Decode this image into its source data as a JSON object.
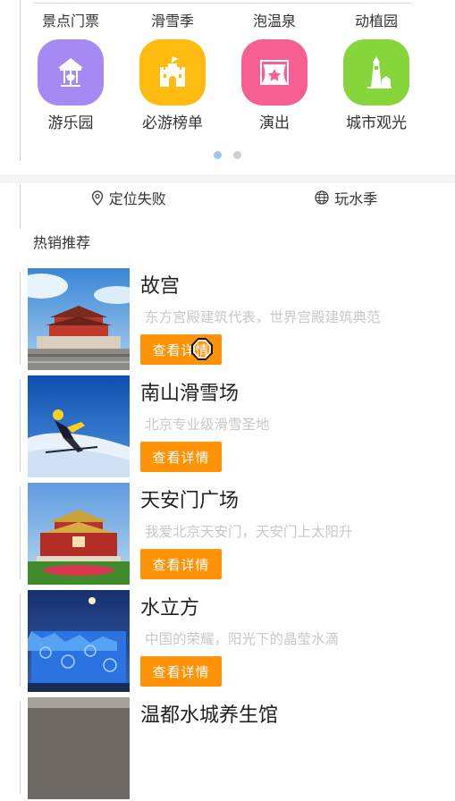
{
  "categories_top": [
    "景点门票",
    "滑雪季",
    "泡温泉",
    "动植园"
  ],
  "categories": [
    {
      "label": "游乐园",
      "icon": "carousel-icon",
      "color": "#a48af2"
    },
    {
      "label": "必游榜单",
      "icon": "castle-icon",
      "color": "#ffbb0f"
    },
    {
      "label": "演出",
      "icon": "stage-icon",
      "color": "#f75f92"
    },
    {
      "label": "城市观光",
      "icon": "lighthouse-icon",
      "color": "#86d53b"
    }
  ],
  "location": {
    "label": "定位失败",
    "icon": "location-pin-icon"
  },
  "season": {
    "label": "玩水季",
    "icon": "globe-icon"
  },
  "section_title": "热销推荐",
  "button_label": "查看详情",
  "items": [
    {
      "name": "故宫",
      "desc": "东方宫殿建筑代表，世界宫殿建筑典范"
    },
    {
      "name": "南山滑雪场",
      "desc": "北京专业级滑雪圣地"
    },
    {
      "name": "天安门广场",
      "desc": "我爱北京天安门，天安门上太阳升"
    },
    {
      "name": "水立方",
      "desc": "中国的荣耀，阳光下的晶莹水滴"
    },
    {
      "name": "温都水城养生馆",
      "desc": ""
    }
  ],
  "colors": {
    "accent": "#ff9307",
    "dot_active": "#9ec5ef",
    "muted_text": "#c8c8c8"
  }
}
